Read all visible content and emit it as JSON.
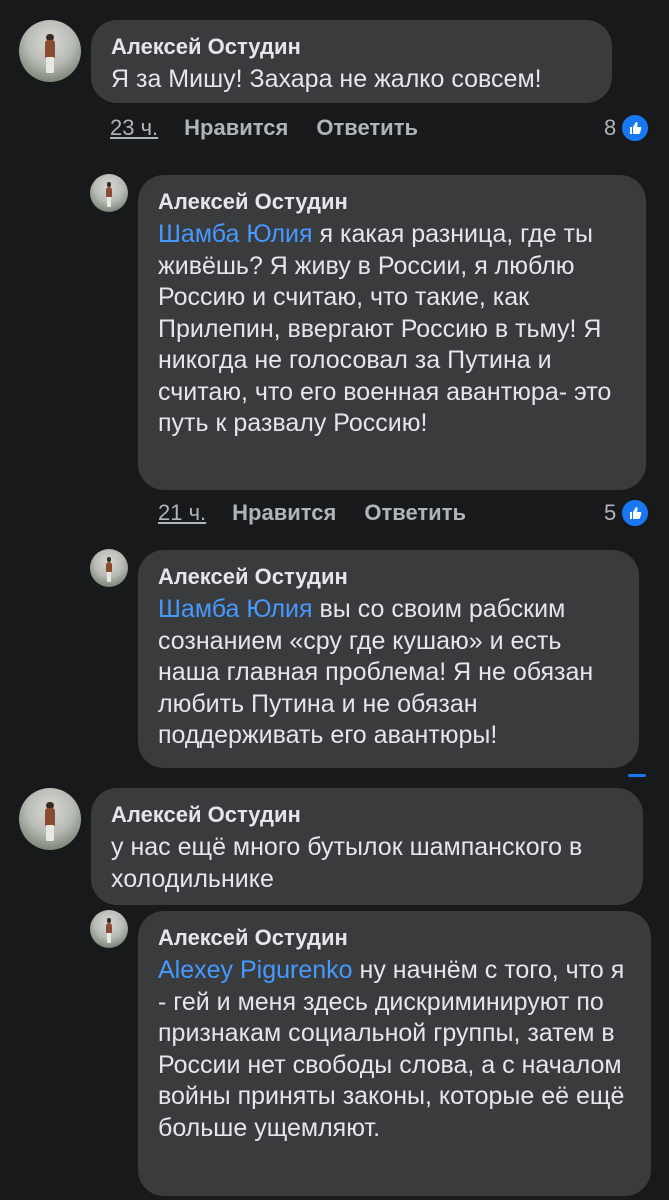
{
  "comments": [
    {
      "author": "Алексей Остудин",
      "text": "Я за Мишу! Захара не жалко совсем!",
      "time": "23 ч.",
      "like_label": "Нравится",
      "reply_label": "Ответить",
      "reaction_count": "8"
    },
    {
      "author": "Алексей Остудин",
      "mention": "Шамба Юлия",
      "text": " я какая разница, где ты живёшь? Я живу в России, я люблю Россию и считаю, что такие, как Прилепин, ввергают Россию в тьму! Я никогда не голосовал за Путина и считаю, что его военная авантюра- это путь к развалу Россию!",
      "time": "21 ч.",
      "like_label": "Нравится",
      "reply_label": "Ответить",
      "reaction_count": "5"
    },
    {
      "author": "Алексей Остудин",
      "mention": "Шамба Юлия",
      "text": " вы со своим рабским сознанием «сру где кушаю» и есть наша главная проблема! Я не обязан любить Путина и не обязан поддерживать его авантюры!"
    },
    {
      "author": "Алексей Остудин",
      "text": "у нас ещё много бутылок шампанского в холодильнике"
    },
    {
      "author": "Алексей Остудин",
      "mention": "Alexey Pigurenko",
      "text": " ну начнём с того, что я - гей и меня здесь дискриминируют по признакам социальной группы, затем в России нет свободы слова, а с началом войны приняты законы, которые её ещё больше ущемляют."
    }
  ],
  "icons": {
    "avatar": "profile-photo",
    "reaction": "thumbs-up-icon"
  },
  "colors": {
    "background": "#18191a",
    "bubble": "#3a3b3c",
    "mention": "#4599ff",
    "like": "#1877f2"
  }
}
